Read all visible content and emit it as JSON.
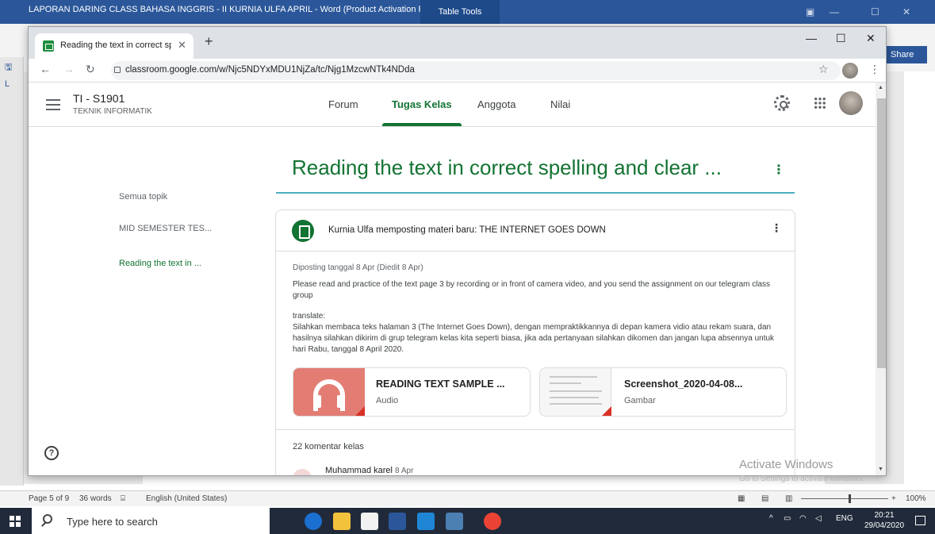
{
  "word": {
    "title": "LAPORAN DARING CLASS BAHASA INGGRIS - II KURNIA ULFA APRIL - Word (Product Activation Failed)",
    "table_tools": "Table Tools",
    "share": "Share",
    "status_page": "Page 5 of 9",
    "status_words": "36 words",
    "status_lang": "English (United States)",
    "zoom": "100%"
  },
  "browser": {
    "tab_title": "Reading the text in correct spelli",
    "url": "classroom.google.com/w/Njc5NDYxMDU1NjZa/tc/Njg1MzcwNTk4NDda"
  },
  "classroom": {
    "class_name": "TI - S1901",
    "class_section": "TEKNIK INFORMATIK",
    "tabs": [
      "Forum",
      "Tugas Kelas",
      "Anggota",
      "Nilai"
    ],
    "active_tab": "Tugas Kelas",
    "topics": [
      "Semua topik",
      "MID SEMESTER TES...",
      "Reading the text in ..."
    ],
    "page_heading": "Reading the text in correct spelling and clear ...",
    "post": {
      "title": "Kurnia Ulfa memposting materi baru: THE INTERNET GOES DOWN",
      "date": "Diposting tanggal 8 Apr (Diedit 8 Apr)",
      "body_en": "Please read and practice of the text page 3 by recording or in front of camera video, and you send the assignment on our telegram class group",
      "translate_label": "translate:",
      "body_id": "Silahkan membaca teks halaman 3 (The Internet Goes Down), dengan mempraktikkannya di depan kamera vidio atau rekam suara, dan hasilnya silahkan dikirim di grup telegram kelas kita seperti biasa, jika ada pertanyaan silahkan dikomen dan jangan lupa absennya untuk hari Rabu, tanggal 8 April 2020.",
      "attachments": [
        {
          "title": "READING TEXT SAMPLE ...",
          "type": "Audio"
        },
        {
          "title": "Screenshot_2020-04-08...",
          "type": "Gambar"
        }
      ],
      "comments_count": "22 komentar kelas",
      "first_comment_author": "Muhammad karel",
      "first_comment_date": "8 Apr"
    }
  },
  "watermark": {
    "line1": "Activate Windows",
    "line2": "Go to Settings to activate Windows."
  },
  "taskbar": {
    "search_placeholder": "Type here to search",
    "lang": "ENG",
    "time": "20:21",
    "date": "29/04/2020"
  },
  "colors": {
    "classroom_green": "#137333",
    "word_blue": "#2b579a",
    "audio_thumb": "#e37d74"
  }
}
